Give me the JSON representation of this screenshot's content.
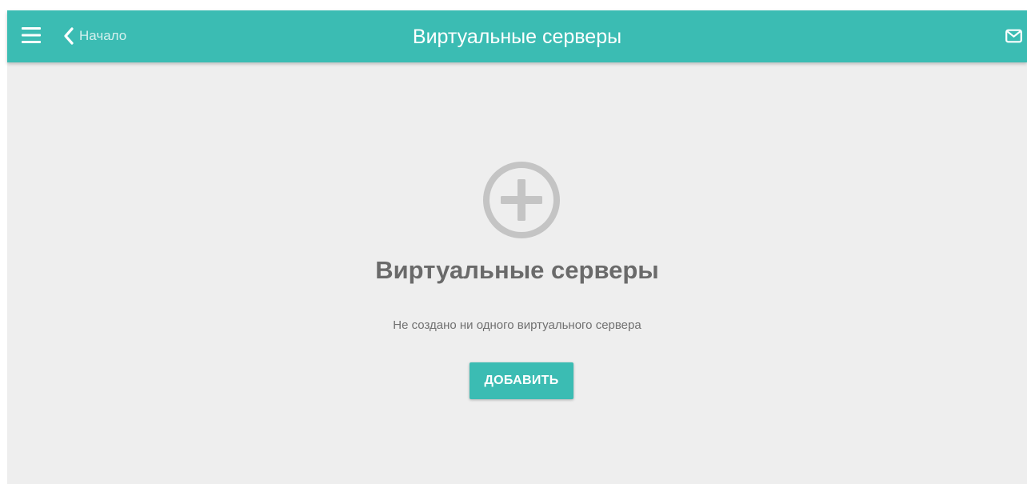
{
  "colors": {
    "header": "#3bbcb3",
    "page_background": "#eeeeee",
    "primary_button": "#3bbcb3",
    "icon_gray": "#c4c4c4",
    "text_gray": "#6a6a6a"
  },
  "header": {
    "menu_icon": "hamburger-menu-icon",
    "back": {
      "icon": "chevron-left-icon",
      "label": "Начало"
    },
    "title": "Виртуальные серверы",
    "mail_icon": "mail-icon"
  },
  "empty_state": {
    "icon": "plus-circle-icon",
    "title": "Виртуальные серверы",
    "subtitle": "Не создано ни одного виртуального сервера",
    "add_button_label": "ДОБАВИТЬ"
  }
}
